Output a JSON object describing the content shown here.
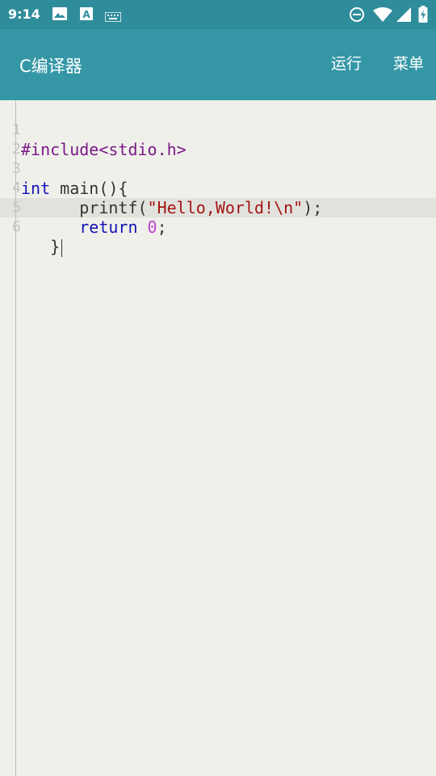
{
  "status_bar": {
    "time": "9:14",
    "left_icons": [
      "image-icon",
      "font-a-icon",
      "keyboard-icon"
    ],
    "right_icons": [
      "do-not-disturb-icon",
      "wifi-icon",
      "signal-icon",
      "battery-charging-icon"
    ]
  },
  "app_bar": {
    "title": "C编译器",
    "run_label": "运行",
    "menu_label": "菜单",
    "color": "#3597a6"
  },
  "editor": {
    "lines": [
      {
        "num": "1",
        "text": "#include<stdio.h>"
      },
      {
        "num": "2",
        "text": ""
      },
      {
        "num": "3",
        "text": "int main(){"
      },
      {
        "num": "4",
        "text": "      printf(\"Hello,World!\\n\");"
      },
      {
        "num": "5",
        "text": "      return 0;"
      },
      {
        "num": "6",
        "text": "   }"
      }
    ],
    "tokens": {
      "l1": "#include<stdio.h>",
      "l3_kw": "int",
      "l3_rest": " main(){",
      "l4_indent": "      ",
      "l4_fn": "printf(",
      "l4_str": "\"Hello,World!\\n\"",
      "l4_end": ");",
      "l5_indent": "      ",
      "l5_kw": "return",
      "l5_sp": " ",
      "l5_num": "0",
      "l5_end": ";",
      "l6": "   }"
    },
    "current_line": 6
  }
}
